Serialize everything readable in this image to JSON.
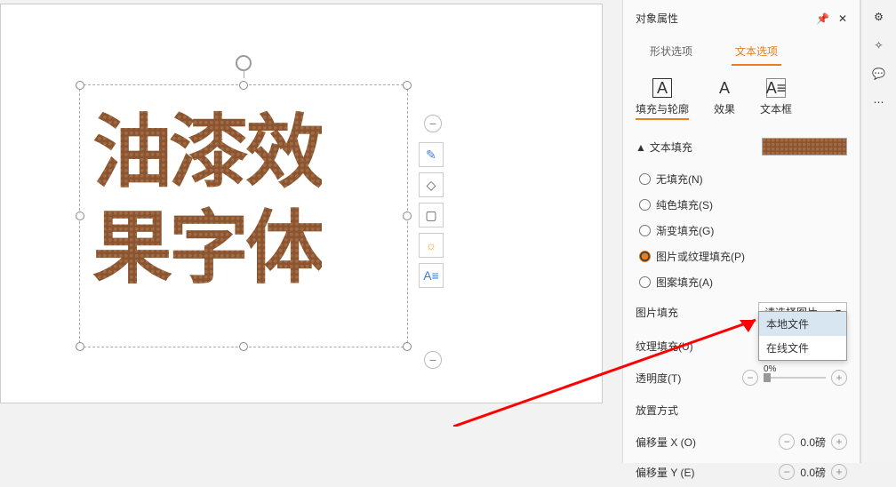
{
  "panel": {
    "title": "对象属性",
    "tabs1": [
      "形状选项",
      "文本选项"
    ],
    "tabs2": [
      {
        "label": "填充与轮廓"
      },
      {
        "label": "效果"
      },
      {
        "label": "文本框"
      }
    ],
    "section_fill": "文本填充",
    "radios": {
      "none": "无填充(N)",
      "solid": "纯色填充(S)",
      "gradient": "渐变填充(G)",
      "picture": "图片或纹理填充(P)",
      "pattern": "图案填充(A)"
    },
    "rows": {
      "pic_fill": "图片填充",
      "pic_fill_select": "请选择图片",
      "texture_fill": "纹理填充(U)",
      "opacity": "透明度(T)",
      "opacity_val": "0%",
      "place_mode": "放置方式",
      "offset_x": "偏移量 X (O)",
      "offset_x_val": "0.0磅",
      "offset_y": "偏移量 Y (E)",
      "offset_y_val": "0.0磅"
    },
    "dropdown": {
      "local": "本地文件",
      "online": "在线文件"
    }
  },
  "canvas": {
    "text": "油漆效\n果字体"
  }
}
